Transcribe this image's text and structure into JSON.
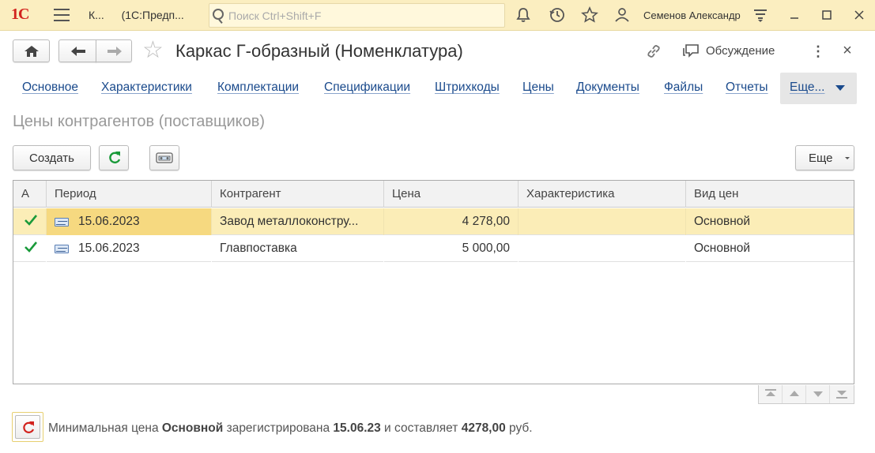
{
  "titlebar": {
    "logo": "1С",
    "title_short": "К...",
    "title_app": "(1С:Предп...",
    "search_placeholder": "Поиск Ctrl+Shift+F",
    "user": "Семенов Александр"
  },
  "header": {
    "doc_title": "Каркас Г-образный (Номенклатура)",
    "discuss_label": "Обсуждение"
  },
  "tabs": [
    "Основное",
    "Характеристики",
    "Комплектации",
    "Спецификации",
    "Штрихкоды",
    "Цены",
    "Документы",
    "Файлы",
    "Отчеты"
  ],
  "tab_more": "Еще...",
  "section_title": "Цены контрагентов (поставщиков)",
  "toolbar": {
    "create": "Создать",
    "more": "Еще"
  },
  "table": {
    "columns": [
      "А",
      "Период",
      "Контрагент",
      "Цена",
      "Характеристика",
      "Вид цен"
    ],
    "rows": [
      {
        "active": true,
        "period": "15.06.2023",
        "counterparty": "Завод металлоконстру...",
        "price": "4 278,00",
        "characteristic": "",
        "price_type": "Основной",
        "selected": true
      },
      {
        "active": true,
        "period": "15.06.2023",
        "counterparty": "Главпоставка",
        "price": "5 000,00",
        "characteristic": "",
        "price_type": "Основной",
        "selected": false
      }
    ]
  },
  "footer": {
    "t1": "Минимальная цена ",
    "b1": "Основной",
    "t2": " зарегистрирована ",
    "b2": "15.06.23",
    "t3": " и составляет ",
    "b3": "4278,00",
    "t4": " руб."
  },
  "colors": {
    "titlebar_bg": "#fbeec0",
    "selected_row": "#fbedb7",
    "check_green": "#1a9a3a",
    "link_blue": "#1a4a8c",
    "refresh_red": "#d2231e"
  }
}
